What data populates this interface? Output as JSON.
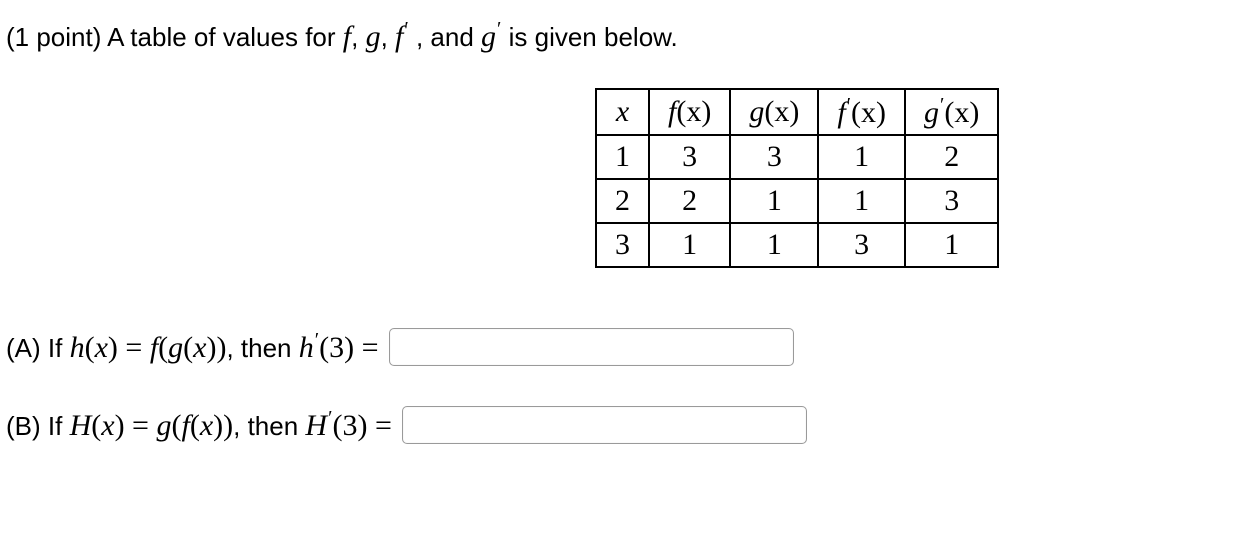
{
  "prompt": {
    "points_label": "(1 point) ",
    "intro_text_1": "A table of values for ",
    "f": "f",
    "comma1": ", ",
    "g": "g",
    "comma2": ", ",
    "fprime": "f",
    "comma3": " , and ",
    "gprime": "g",
    "outro": "  is given below."
  },
  "table": {
    "headers": {
      "x": "x",
      "fx_f": "f",
      "fx_x": "(x)",
      "gx_g": "g",
      "gx_x": "(x)",
      "fpx_f": "f",
      "fpx_x": "(x)",
      "gpx_g": "g",
      "gpx_x": "(x)"
    },
    "rows": [
      {
        "x": "1",
        "fx": "3",
        "gx": "3",
        "fpx": "1",
        "gpx": "2"
      },
      {
        "x": "2",
        "fx": "2",
        "gx": "1",
        "fpx": "1",
        "gpx": "3"
      },
      {
        "x": "3",
        "fx": "1",
        "gx": "1",
        "fpx": "3",
        "gpx": "1"
      }
    ]
  },
  "questions": {
    "A": {
      "label_prefix": "(A) If ",
      "hx": "h",
      "x1": "(",
      "xvar1": "x",
      "x2": ") = ",
      "f": "f",
      "paren1": "(",
      "g": "g",
      "paren2": "(",
      "xvar2": "x",
      "paren3": "))",
      "mid": ", then ",
      "hprime": "h",
      "arg": "(3) = ",
      "answer": ""
    },
    "B": {
      "label_prefix": "(B) If ",
      "Hx": "H",
      "x1": "(",
      "xvar1": "x",
      "x2": ") = ",
      "g": "g",
      "paren1": "(",
      "f": "f",
      "paren2": "(",
      "xvar2": "x",
      "paren3": "))",
      "mid": ", then ",
      "Hprime": "H",
      "arg": "(3) = ",
      "answer": ""
    }
  }
}
